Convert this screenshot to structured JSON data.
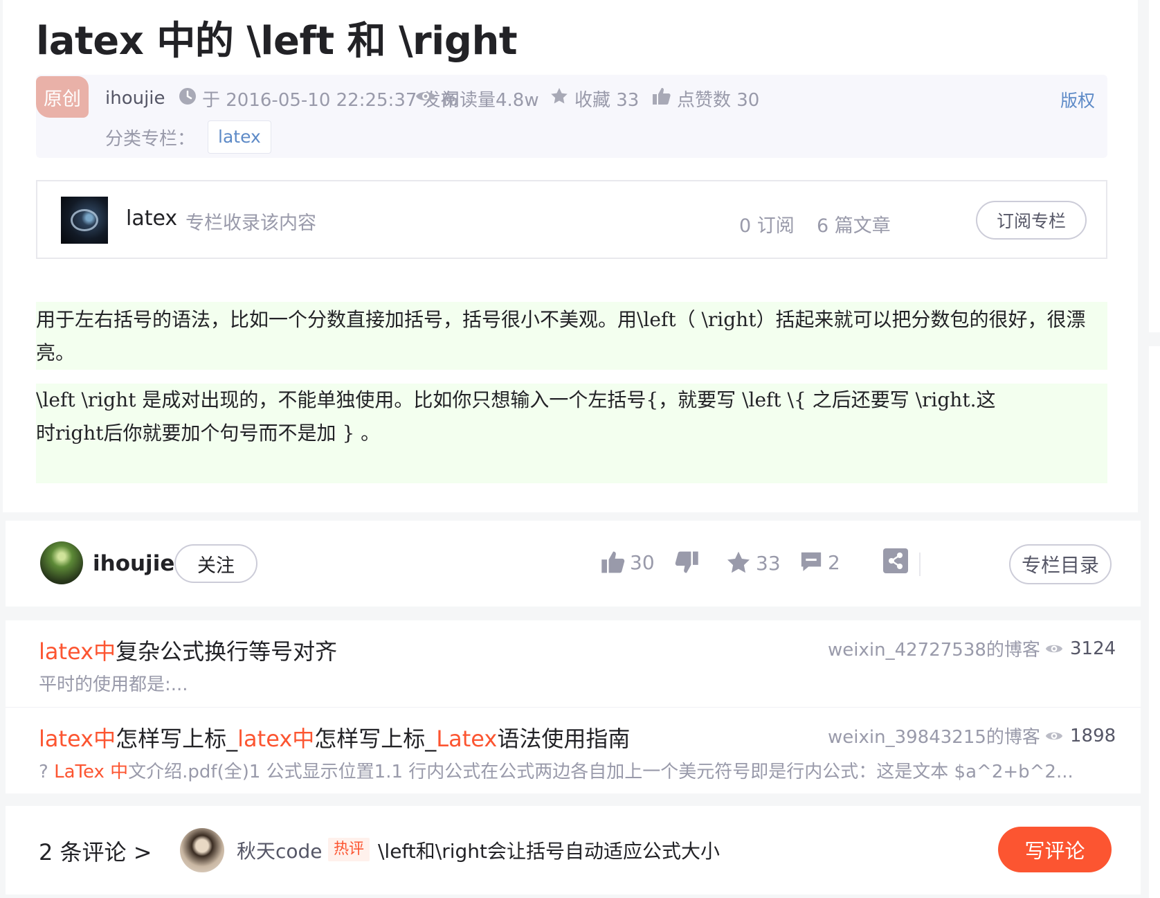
{
  "article": {
    "title": "latex 中的 \\left 和 \\right",
    "badge": "原创",
    "author": "ihoujie",
    "published": "于 2016-05-10 22:25:37 发布",
    "reads": "阅读量4.8w",
    "favorites": "收藏 33",
    "likes": "点赞数 30",
    "copyright": "版权",
    "category_label": "分类专栏：",
    "category_tag": "latex"
  },
  "column": {
    "name": "latex",
    "desc": "专栏收录该内容",
    "subscribers": "0 订阅",
    "articles": "6 篇文章",
    "subscribe_button": "订阅专栏"
  },
  "content": {
    "para1_line1": "用于左右括号的语法，比如一个分数直接加括号，括号很小不美观。用\\left（   \\right）括起来就可以把分数包的很好，很漂",
    "para1_line2": "亮。",
    "para2_line1": "\\left \\right 是成对出现的，不能单独使用。比如你只想输入一个左括号{，就要写 \\left \\{ 之后还要写 \\right.这",
    "para2_line2": "时right后你就要加个句号而不是加 } 。"
  },
  "action_bar": {
    "author": "ihoujie",
    "follow": "关注",
    "likes": "30",
    "favorites": "33",
    "comments": "2",
    "catalog": "专栏目录"
  },
  "related": [
    {
      "title_hl1": "latex中",
      "title_rest1": "复杂公式换行等号对齐",
      "title_hl2": "",
      "title_rest2": "",
      "title_hl3": "",
      "title_rest3": "",
      "desc_plain1": "平时的使用都是:...",
      "desc_hl": "",
      "desc_plain2": "",
      "blog": "weixin_42727538的博客",
      "views": "3124"
    },
    {
      "title_hl1": "latex中",
      "title_rest1": "怎样写上标_",
      "title_hl2": "latex中",
      "title_rest2": "怎样写上标_",
      "title_hl3": "Latex",
      "title_rest3": "语法使用指南",
      "desc_plain1": "? ",
      "desc_hl": "LaTex 中",
      "desc_plain2": "文介绍.pdf(全)1 公式显示位置1.1 行内公式在公式两边各自加上一个美元符号即是行内公式：这是文本 $a^2+b^2...",
      "blog": "weixin_39843215的博客",
      "views": "1898"
    }
  ],
  "comments": {
    "count": "2 条评论 >",
    "user": "秋天code",
    "hot_tag": "热评",
    "text": "\\left和\\right会让括号自动适应公式大小",
    "write": "写评论"
  }
}
